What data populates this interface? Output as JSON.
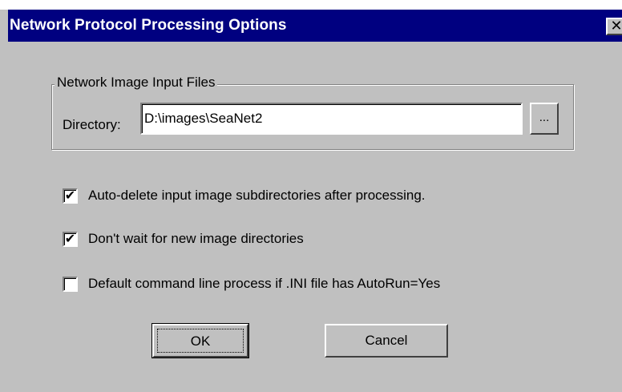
{
  "window": {
    "title": "Network Protocol Processing Options",
    "close_glyph": "✕"
  },
  "input_group": {
    "legend": "Network Image Input Files",
    "directory_label": "Directory:",
    "directory_value": "D:\\images\\SeaNet2",
    "browse_label": "..."
  },
  "options": [
    {
      "label": "Auto-delete input image subdirectories after processing.",
      "checked": true
    },
    {
      "label": "Don't wait for new image directories",
      "checked": true
    },
    {
      "label": "Default command line process if .INI file has AutoRun=Yes",
      "checked": false
    }
  ],
  "buttons": {
    "ok_label": "OK",
    "cancel_label": "Cancel"
  },
  "colors": {
    "titlebar": "#000080",
    "face": "#c0c0c0"
  }
}
